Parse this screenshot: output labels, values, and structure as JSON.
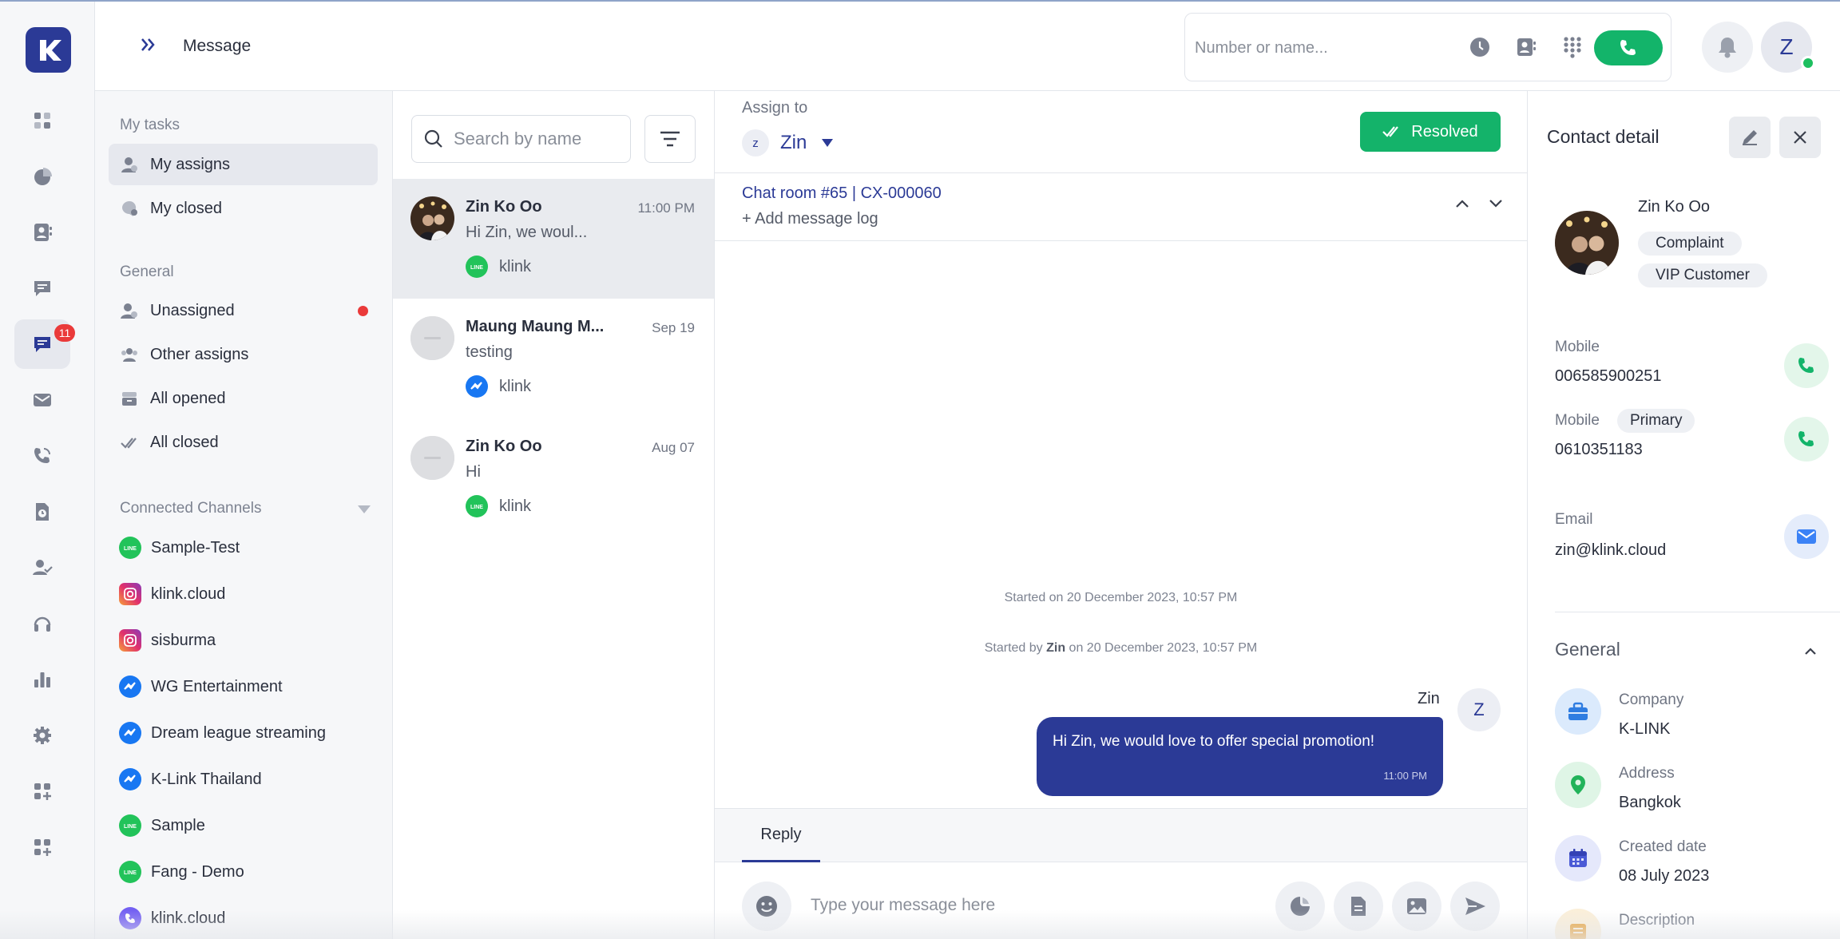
{
  "app": {
    "header_title": "Message",
    "dialer_placeholder": "Number or name...",
    "user_initial": "Z",
    "rail_badge": "11"
  },
  "colors": {
    "brand": "#2b3a96",
    "success": "#14b36a",
    "alert": "#ea3a3a"
  },
  "rail": {
    "items": [
      {
        "icon": "dashboard-icon"
      },
      {
        "icon": "pie-chart-icon"
      },
      {
        "icon": "contacts-icon"
      },
      {
        "icon": "notes-icon"
      },
      {
        "icon": "chat-icon",
        "active": true
      },
      {
        "icon": "mail-icon"
      },
      {
        "icon": "phone-call-icon"
      },
      {
        "icon": "history-file-icon"
      },
      {
        "icon": "user-check-icon"
      },
      {
        "icon": "headset-icon"
      },
      {
        "icon": "bar-chart-icon"
      },
      {
        "icon": "settings-icon"
      },
      {
        "icon": "add-app-icon"
      },
      {
        "icon": "add-app-icon"
      }
    ]
  },
  "nav": {
    "my_tasks_label": "My tasks",
    "my_assigns": "My assigns",
    "my_closed": "My closed",
    "general_label": "General",
    "unassigned": "Unassigned",
    "other_assigns": "Other assigns",
    "all_opened": "All opened",
    "all_closed": "All closed",
    "channels_label": "Connected Channels",
    "channels": [
      {
        "name": "Sample-Test",
        "type": "line"
      },
      {
        "name": "klink.cloud",
        "type": "instagram"
      },
      {
        "name": "sisburma",
        "type": "instagram"
      },
      {
        "name": "WG Entertainment",
        "type": "messenger"
      },
      {
        "name": "Dream league streaming",
        "type": "messenger"
      },
      {
        "name": "K-Link Thailand",
        "type": "messenger"
      },
      {
        "name": "Sample",
        "type": "line"
      },
      {
        "name": "Fang - Demo",
        "type": "line"
      },
      {
        "name": "klink.cloud",
        "type": "viber"
      }
    ]
  },
  "conversations": {
    "search_placeholder": "Search by name",
    "items": [
      {
        "name": "Zin Ko Oo",
        "time": "11:00 PM",
        "preview": "Hi Zin, we woul...",
        "channel": "klink",
        "channel_type": "line"
      },
      {
        "name": "Maung Maung M...",
        "time": "Sep 19",
        "preview": "testing",
        "channel": "klink",
        "channel_type": "messenger"
      },
      {
        "name": "Zin Ko Oo",
        "time": "Aug 07",
        "preview": "Hi",
        "channel": "klink",
        "channel_type": "line"
      }
    ]
  },
  "chat": {
    "assign_label": "Assign to",
    "assignee_initial": "z",
    "assignee": "Zin",
    "resolved_label": "Resolved",
    "room_title": "Chat room #65 | CX-000060",
    "add_log": "+ Add message log",
    "started_on": "Started on 20 December 2023, 10:57 PM",
    "started_by_prefix": "Started by ",
    "started_by_name": "Zin",
    "started_by_suffix": " on 20 December 2023, 10:57 PM",
    "sender": "Zin",
    "sender_initial": "Z",
    "message": "Hi Zin, we would love to offer special promotion!",
    "message_time": "11:00 PM",
    "reply_tab": "Reply",
    "composer_placeholder": "Type your message here"
  },
  "contact": {
    "title": "Contact detail",
    "name": "Zin Ko Oo",
    "tags": [
      "Complaint",
      "VIP Customer"
    ],
    "mobile_label": "Mobile",
    "mobile_1": "006585900251",
    "mobile_2_label": "Mobile",
    "primary_tag": "Primary",
    "mobile_2": "0610351183",
    "email_label": "Email",
    "email": "zin@klink.cloud",
    "general_title": "General",
    "company_label": "Company",
    "company": "K-LINK",
    "address_label": "Address",
    "address": "Bangkok",
    "created_label": "Created date",
    "created": "08 July 2023",
    "description_label": "Description"
  }
}
